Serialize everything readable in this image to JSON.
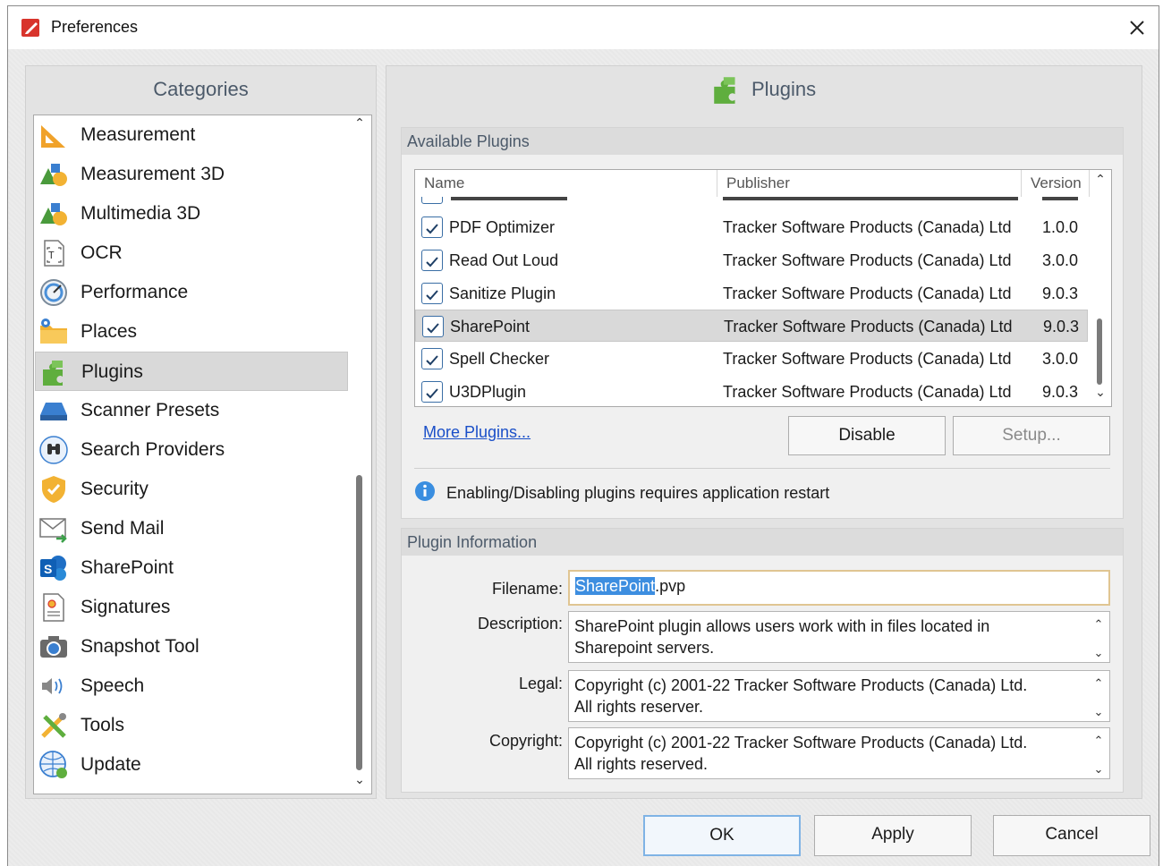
{
  "window": {
    "title": "Preferences"
  },
  "categories": {
    "header": "Categories",
    "items": [
      {
        "label": "Measurement",
        "icon": "ruler-triangle-icon"
      },
      {
        "label": "Measurement 3D",
        "icon": "shapes-3d-icon"
      },
      {
        "label": "Multimedia 3D",
        "icon": "shapes-3d-icon"
      },
      {
        "label": "OCR",
        "icon": "ocr-icon"
      },
      {
        "label": "Performance",
        "icon": "gauge-icon"
      },
      {
        "label": "Places",
        "icon": "folder-pin-icon"
      },
      {
        "label": "Plugins",
        "icon": "puzzle-icon"
      },
      {
        "label": "Scanner Presets",
        "icon": "scanner-icon"
      },
      {
        "label": "Search Providers",
        "icon": "binoculars-globe-icon"
      },
      {
        "label": "Security",
        "icon": "shield-icon"
      },
      {
        "label": "Send Mail",
        "icon": "envelope-icon"
      },
      {
        "label": "SharePoint",
        "icon": "sharepoint-icon"
      },
      {
        "label": "Signatures",
        "icon": "certificate-icon"
      },
      {
        "label": "Snapshot Tool",
        "icon": "camera-icon"
      },
      {
        "label": "Speech",
        "icon": "speaker-icon"
      },
      {
        "label": "Tools",
        "icon": "tools-icon"
      },
      {
        "label": "Update",
        "icon": "globe-update-icon"
      }
    ],
    "selected": "Plugins"
  },
  "plugins_page": {
    "header": "Plugins",
    "available": {
      "title": "Available Plugins",
      "columns": [
        "Name",
        "Publisher",
        "Version"
      ],
      "rows": [
        {
          "name": "PDF Optimizer",
          "publisher": "Tracker Software Products (Canada) Ltd",
          "version": "1.0.0",
          "checked": true
        },
        {
          "name": "Read Out Loud",
          "publisher": "Tracker Software Products (Canada) Ltd",
          "version": "3.0.0",
          "checked": true
        },
        {
          "name": "Sanitize Plugin",
          "publisher": "Tracker Software Products (Canada) Ltd",
          "version": "9.0.3",
          "checked": true
        },
        {
          "name": "SharePoint",
          "publisher": "Tracker Software Products (Canada) Ltd",
          "version": "9.0.3",
          "checked": true
        },
        {
          "name": "Spell Checker",
          "publisher": "Tracker Software Products (Canada) Ltd",
          "version": "3.0.0",
          "checked": true
        },
        {
          "name": "U3DPlugin",
          "publisher": "Tracker Software Products (Canada) Ltd",
          "version": "9.0.3",
          "checked": true
        }
      ],
      "selected_row": "SharePoint",
      "more_link": "More Plugins...",
      "disable_button": "Disable",
      "setup_button": "Setup...",
      "info_text": "Enabling/Disabling plugins requires application restart"
    },
    "info": {
      "title": "Plugin Information",
      "filename_label": "Filename:",
      "filename_selected": "SharePoint",
      "filename_rest": ".pvp",
      "description_label": "Description:",
      "description_line1": "SharePoint plugin allows users work with in files located in",
      "description_line2": "Sharepoint servers.",
      "legal_label": "Legal:",
      "legal_line1": "Copyright (c) 2001-22 Tracker Software Products (Canada) Ltd.",
      "legal_line2": "All rights reserver.",
      "copyright_label": "Copyright:",
      "copyright_line1": "Copyright (c) 2001-22 Tracker Software Products (Canada) Ltd.",
      "copyright_line2": "All rights reserved."
    }
  },
  "footer": {
    "ok": "OK",
    "apply": "Apply",
    "cancel": "Cancel"
  },
  "colors": {
    "accent": "#3d8ee0",
    "link": "#1a4fc8",
    "header_text": "#4c5a6a"
  }
}
